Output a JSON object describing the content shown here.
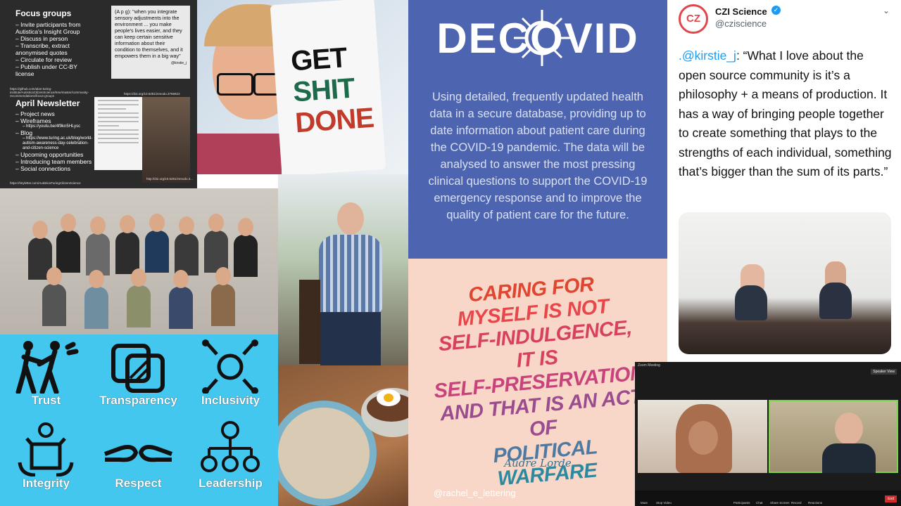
{
  "slide": {
    "focus_title": "Focus groups",
    "focus_items": [
      "Invite participants from Autistica's Insight Group",
      "Discuss in person",
      "Transcribe, extract anonymised quotes",
      "Circulate for review",
      "Publish under CC-BY license"
    ],
    "quote": "(A p g): \"when you integrate sensory adjustments into the environment ... you make people's lives easier, and they can keep certain sensitive information about their condition to themselves, and it empowers them in a big way\"",
    "quote_credit": "@kirstie_j",
    "link1": "https://github.com/alan-turing-institute/AutisticaCitizenScience/tree/master/community-recommendations/focus-groups",
    "link2": "https://doi.org/10.5281/zenodo.3766922",
    "newsletter_title": "April Newsletter",
    "newsletter_items": [
      "Project news",
      "Wireframes",
      "Blog",
      "Upcoming opportunities",
      "Introducing team members",
      "Social connections"
    ],
    "wireframes_sub": "https://youtu.be/4f9kn5HLysc",
    "blog_sub": "https://www.turing.ac.uk/blog/world-autism-awareness-day-celebration-and-citizen-science",
    "link3": "https://tinyletter.com/AutisticaTuringCitizenScience",
    "link4": "http://doi.org/10.5281/zenodo.3..."
  },
  "gsd": {
    "line1": "GET",
    "line2": "SHIT",
    "line3": "DONE"
  },
  "decovid": {
    "logo": "DECOVID",
    "text": "Using detailed, frequently updated health data in a secure database, providing up to date information about patient care during the COVID-19 pandemic. The data will be analysed to answer the most pressing clinical questions to support the COVID-19 emergency response and to improve the quality of patient care for the future."
  },
  "tweet": {
    "avatar_text": "CZ",
    "name": "CZI Science",
    "handle": "@cziscience",
    "mention": ".@kirstie_j",
    "text": ": “What I love about the open source community is it’s a philosophy + a means of production. It has a way of bringing people together to create something that plays to the strengths of each individual, something that’s bigger than the sum of its parts.”"
  },
  "values": [
    {
      "label": "Trust",
      "icon": "trust-icon"
    },
    {
      "label": "Transparency",
      "icon": "transparency-icon"
    },
    {
      "label": "Inclusivity",
      "icon": "inclusivity-icon"
    },
    {
      "label": "Integrity",
      "icon": "integrity-icon"
    },
    {
      "label": "Respect",
      "icon": "respect-icon"
    },
    {
      "label": "Leadership",
      "icon": "leadership-icon"
    }
  ],
  "quote": {
    "lines": [
      "CARING FOR",
      "MYSELF IS NOT",
      "SELF-INDULGENCE, IT IS",
      "SELF-PRESERVATION",
      "AND THAT IS AN ACT OF",
      "POLITICAL",
      "WARFARE"
    ],
    "author": "Audre Lorde",
    "credit": "@rachel_e_lettering"
  },
  "zoom": {
    "window_title": "Zoom Meeting",
    "view_button": "Speaker View",
    "toolbar": [
      "Mute",
      "Stop Video",
      "Participants",
      "Chat",
      "Share Screen",
      "Record",
      "Reactions"
    ],
    "end_button": "End"
  }
}
